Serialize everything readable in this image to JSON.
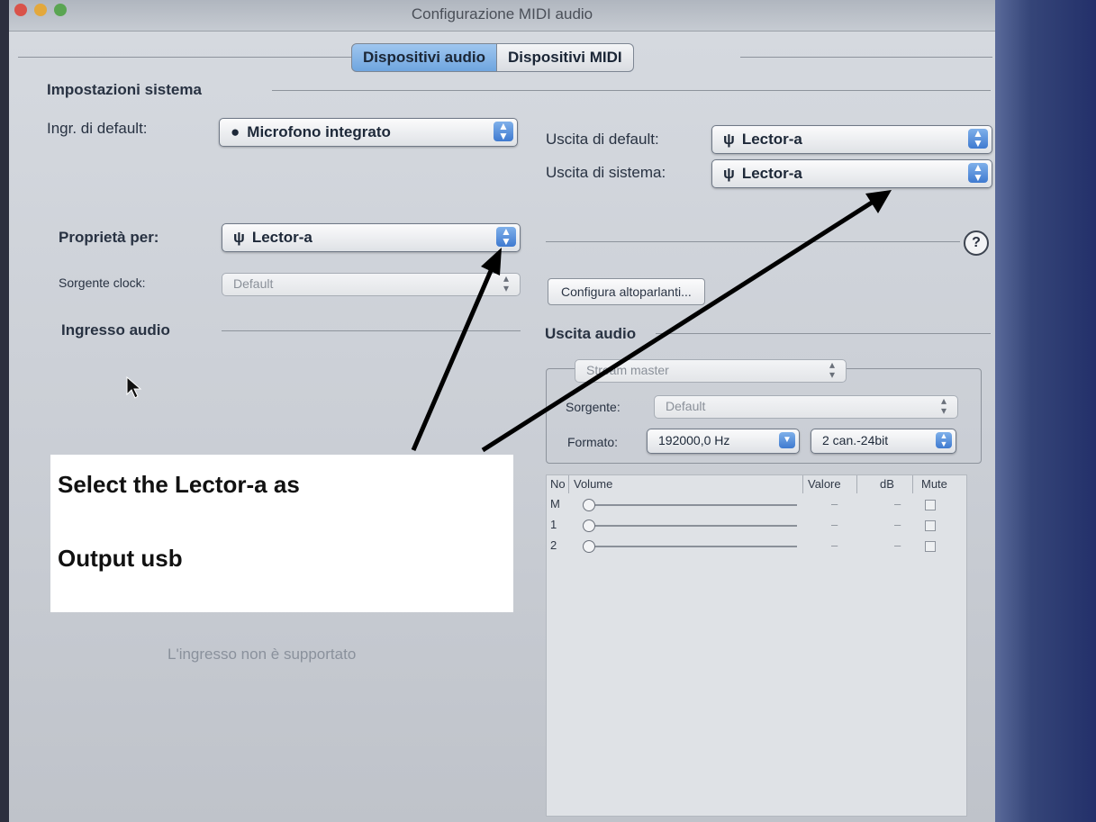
{
  "window": {
    "title": "Configurazione MIDI audio"
  },
  "tabs": [
    {
      "label": "Dispositivi audio",
      "selected": true
    },
    {
      "label": "Dispositivi MIDI",
      "selected": false
    }
  ],
  "system_settings": {
    "heading": "Impostazioni sistema",
    "default_input_label": "Ingr. di default:",
    "default_input_value": "Microfono integrato",
    "default_input_icon": "apple-icon",
    "default_output_label": "Uscita di default:",
    "default_output_value": "Lector-a",
    "default_output_icon": "usb-icon",
    "system_output_label": "Uscita di sistema:",
    "system_output_value": "Lector-a",
    "system_output_icon": "usb-icon"
  },
  "properties": {
    "label": "Proprietà per:",
    "value": "Lector-a",
    "icon": "usb-icon",
    "help": "?",
    "clock_label": "Sorgente clock:",
    "clock_value": "Default",
    "configure_speakers": "Configura altoparlanti..."
  },
  "audio_input": {
    "heading": "Ingresso audio",
    "unsupported": "L'ingresso non è supportato"
  },
  "audio_output": {
    "heading": "Uscita audio",
    "stream": "Stream master",
    "source_label": "Sorgente:",
    "source_value": "Default",
    "format_label": "Formato:",
    "format_rate": "192000,0 Hz",
    "format_bits": "2 can.-24bit",
    "table": {
      "headers": [
        "No",
        "Volume",
        "Valore",
        "dB",
        "Mute"
      ],
      "rows": [
        {
          "no": "M",
          "value": "–",
          "db": "–",
          "mute": false
        },
        {
          "no": "1",
          "value": "–",
          "db": "–",
          "mute": false
        },
        {
          "no": "2",
          "value": "–",
          "db": "–",
          "mute": false
        }
      ]
    }
  },
  "annotation": {
    "line1": "Select the Lector-a    as",
    "line2": "Output usb",
    "arrow_color": "#000000"
  },
  "colors": {
    "accent": "#6fa5df",
    "window": "#d6dae0"
  }
}
